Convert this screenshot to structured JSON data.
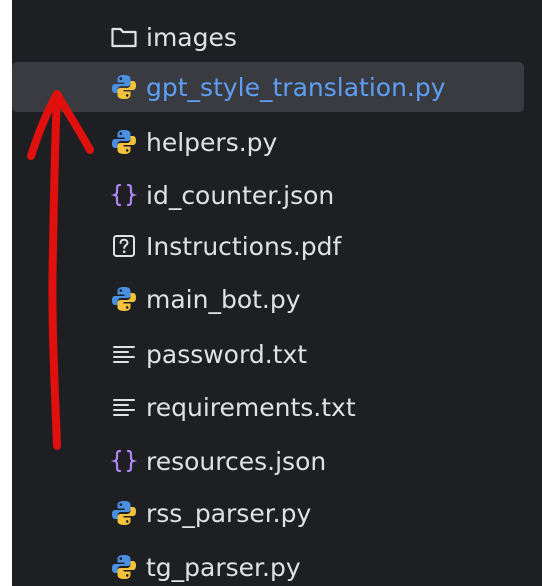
{
  "project_tree": {
    "items": [
      {
        "label": "images",
        "icon": "folder-icon",
        "selected": false
      },
      {
        "label": "gpt_style_translation.py",
        "icon": "python-file-icon",
        "selected": true
      },
      {
        "label": "helpers.py",
        "icon": "python-file-icon",
        "selected": false
      },
      {
        "label": "id_counter.json",
        "icon": "json-file-icon",
        "selected": false
      },
      {
        "label": "Instructions.pdf",
        "icon": "unknown-file-icon",
        "selected": false
      },
      {
        "label": "main_bot.py",
        "icon": "python-file-icon",
        "selected": false
      },
      {
        "label": "password.txt",
        "icon": "text-file-icon",
        "selected": false
      },
      {
        "label": "requirements.txt",
        "icon": "text-file-icon",
        "selected": false
      },
      {
        "label": "resources.json",
        "icon": "json-file-icon",
        "selected": false
      },
      {
        "label": "rss_parser.py",
        "icon": "python-file-icon",
        "selected": false
      },
      {
        "label": "tg_parser.py",
        "icon": "python-file-icon",
        "selected": false
      }
    ]
  },
  "colors": {
    "panel_background": "#1e1f22",
    "selected_row_background": "#393b40",
    "selected_text": "#5e9ff5",
    "default_text": "#dfe1e5",
    "annotation_arrow": "#e0100f",
    "python_blue": "#4a8fe0",
    "python_yellow": "#f5c23b",
    "json_purple": "#b085f5"
  }
}
